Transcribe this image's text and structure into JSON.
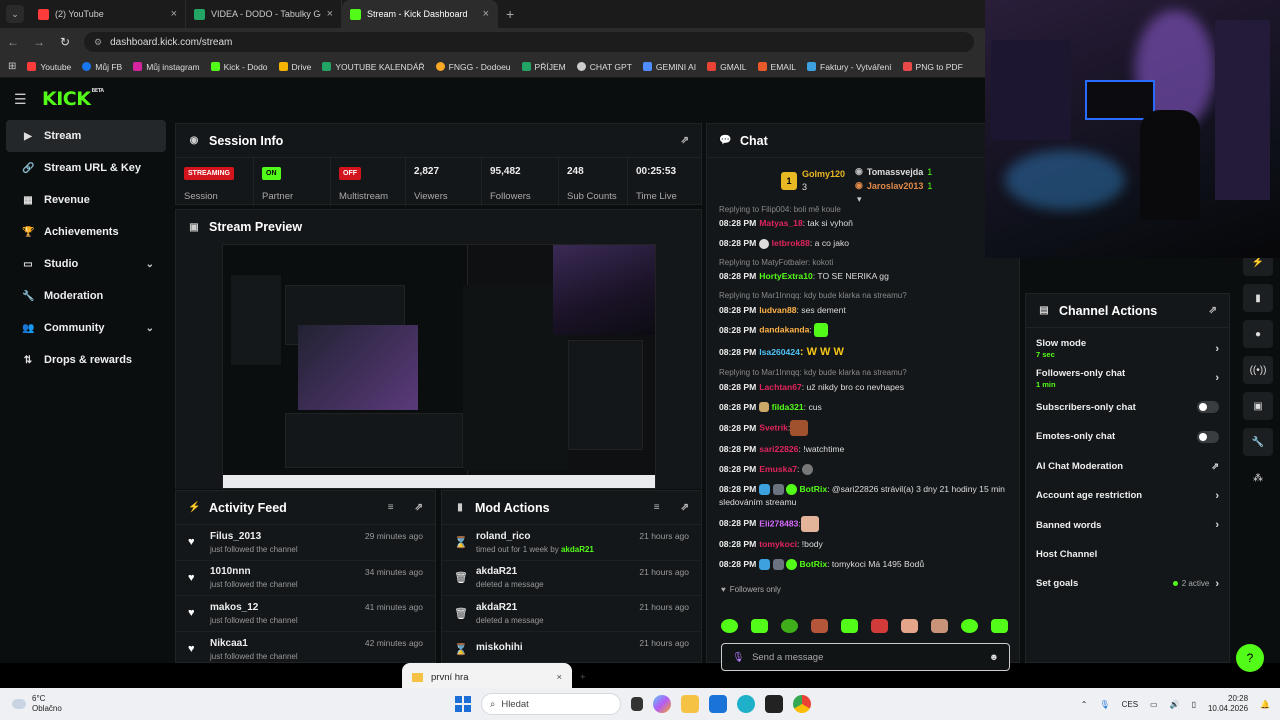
{
  "browser": {
    "tabs": [
      {
        "title": "(2) YouTube",
        "color": "#ff3b3b"
      },
      {
        "title": "VIDEA - DODO - Tabulky Googl",
        "color": "#21a464"
      },
      {
        "title": "Stream - Kick Dashboard",
        "color": "#53fc18"
      }
    ],
    "url": "dashboard.kick.com/stream",
    "bookmarks": [
      {
        "label": "Youtube",
        "color": "#ff3b3b"
      },
      {
        "label": "Můj FB",
        "color": "#1877f2"
      },
      {
        "label": "Můj instagram",
        "color": "#d6249f"
      },
      {
        "label": "Kick - Dodo",
        "color": "#53fc18"
      },
      {
        "label": "Drive",
        "color": "#f4b400"
      },
      {
        "label": "YOUTUBE KALENDÁŘ",
        "color": "#21a464"
      },
      {
        "label": "FNGG - Dodoeu",
        "color": "#f9a825"
      },
      {
        "label": "PŘÍJEM",
        "color": "#21a464"
      },
      {
        "label": "CHAT GPT",
        "color": "#cccccc"
      },
      {
        "label": "GEMINI AI",
        "color": "#4e8cff"
      },
      {
        "label": "GMAIL",
        "color": "#ea4335"
      },
      {
        "label": "EMAIL",
        "color": "#e85a2a"
      },
      {
        "label": "Faktury - Vytváření",
        "color": "#3da1e0"
      },
      {
        "label": "PNG to PDF",
        "color": "#e84a4a"
      }
    ]
  },
  "brand": {
    "logo": "KICK",
    "beta": "BETA"
  },
  "sidebar": {
    "items": [
      {
        "label": "Stream",
        "icon": "▶"
      },
      {
        "label": "Stream URL & Key",
        "icon": "🔗"
      },
      {
        "label": "Revenue",
        "icon": "▦"
      },
      {
        "label": "Achievements",
        "icon": "🏆"
      },
      {
        "label": "Studio",
        "icon": "▭"
      },
      {
        "label": "Moderation",
        "icon": "🔧"
      },
      {
        "label": "Community",
        "icon": "👥"
      },
      {
        "label": "Drops & rewards",
        "icon": "⇅"
      }
    ]
  },
  "session": {
    "title": "Session Info",
    "stats": [
      {
        "pill": "STREAMING",
        "caption": "Session"
      },
      {
        "pill": "ON",
        "caption": "Partner"
      },
      {
        "pill": "OFF",
        "caption": "Multistream"
      },
      {
        "value": "2,827",
        "caption": "Viewers"
      },
      {
        "value": "95,482",
        "caption": "Followers"
      },
      {
        "value": "248",
        "caption": "Sub Counts"
      },
      {
        "value": "00:25:53",
        "caption": "Time Live"
      }
    ]
  },
  "preview": {
    "title": "Stream Preview"
  },
  "activity": {
    "title": "Activity Feed",
    "items": [
      {
        "name": "Filus_2013",
        "sub": "just followed the channel",
        "time": "29 minutes ago"
      },
      {
        "name": "1010nnn",
        "sub": "just followed the channel",
        "time": "34 minutes ago"
      },
      {
        "name": "makos_12",
        "sub": "just followed the channel",
        "time": "41 minutes ago"
      },
      {
        "name": "Nikcaa1",
        "sub": "just followed the channel",
        "time": "42 minutes ago"
      }
    ]
  },
  "mod": {
    "title": "Mod Actions",
    "items": [
      {
        "name": "roland_rico",
        "sub": "timed out for 1 week by",
        "by": "akdaR21",
        "time": "21 hours ago"
      },
      {
        "name": "akdaR21",
        "sub": "deleted a message",
        "by": "",
        "time": "21 hours ago"
      },
      {
        "name": "akdaR21",
        "sub": "deleted a message",
        "by": "",
        "time": "21 hours ago"
      },
      {
        "name": "miskohihi",
        "sub": "",
        "by": "",
        "time": "21 hours ago"
      }
    ]
  },
  "chat": {
    "title": "Chat",
    "top": {
      "first": "Golmy120",
      "first_count": "3",
      "second": "Tomassvejda",
      "second_count": "1",
      "third": "Jaroslav2013",
      "third_count": "1",
      "rank": "1"
    },
    "messages": [
      {
        "reply": "Replying to Filip004: boli mě koule",
        "time": "08:28 PM",
        "user": "Matyas_18",
        "color": "#e0245e",
        "text": ": tak si vyhoň"
      },
      {
        "reply": "",
        "time": "08:28 PM",
        "user": "letbrok88",
        "color": "#e0245e",
        "text": ": a co jako"
      },
      {
        "reply": "Replying to MatyFotbaler: kokoti",
        "time": "08:28 PM",
        "user": "HortyExtra10",
        "color": "#53fc18",
        "text": ": TO SE NERIKA gg"
      },
      {
        "reply": "Replying to Mar1Innqq: kdy bude klarka na streamu?",
        "time": "08:28 PM",
        "user": "ludvan88",
        "color": "#ffb347",
        "text": ": ses dement"
      },
      {
        "reply": "",
        "time": "08:28 PM",
        "user": "dandakanda",
        "color": "#ffb347",
        "text": ":"
      },
      {
        "reply": "",
        "time": "08:28 PM",
        "user": "Isa260424",
        "color": "#4fc3f7",
        "text": ": W W W"
      },
      {
        "reply": "Replying to Mar1Innqq: kdy bude klarka na streamu?",
        "time": "08:28 PM",
        "user": "Lachtan67",
        "color": "#e0245e",
        "text": ": už nikdy bro co nevhapes"
      },
      {
        "reply": "",
        "time": "08:28 PM",
        "user": "filda321",
        "color": "#53fc18",
        "text": ": cus"
      },
      {
        "reply": "",
        "time": "08:28 PM",
        "user": "Svetrik",
        "color": "#e0245e",
        "text": ":"
      },
      {
        "reply": "",
        "time": "08:28 PM",
        "user": "sari22826",
        "color": "#e0245e",
        "text": ": !watchtime"
      },
      {
        "reply": "",
        "time": "08:28 PM",
        "user": "Emuska7",
        "color": "#e0245e",
        "text": ":"
      },
      {
        "reply": "",
        "time": "08:28 PM",
        "user": "BotRix",
        "color": "#53fc18",
        "text": ": @sari22826 strávil(a) 3 dny 21 hodiny 15 min sledováním streamu"
      },
      {
        "reply": "",
        "time": "08:28 PM",
        "user": "Eli278483",
        "color": "#d66bff",
        "text": ":"
      },
      {
        "reply": "",
        "time": "08:28 PM",
        "user": "tomykoci",
        "color": "#e0245e",
        "text": ": !body"
      },
      {
        "reply": "",
        "time": "08:28 PM",
        "user": "BotRix",
        "color": "#53fc18",
        "text": ": tomykoci Má 1495 Bodů"
      }
    ],
    "followers_only": "Followers only",
    "placeholder": "Send a message"
  },
  "channel_actions": {
    "title": "Channel Actions",
    "items": [
      {
        "label": "Slow mode",
        "sub": "7 sec",
        "control": "chevron"
      },
      {
        "label": "Followers-only chat",
        "sub": "1 min",
        "control": "chevron"
      },
      {
        "label": "Subscribers-only chat",
        "sub": "",
        "control": "toggle"
      },
      {
        "label": "Emotes-only chat",
        "sub": "",
        "control": "toggle"
      },
      {
        "label": "AI Chat Moderation",
        "sub": "",
        "control": "pop"
      },
      {
        "label": "Account age restriction",
        "sub": "",
        "control": "chevron"
      },
      {
        "label": "Banned words",
        "sub": "",
        "control": "chevron"
      },
      {
        "label": "Host Channel",
        "sub": "",
        "control": "none"
      },
      {
        "label": "Set goals",
        "sub": "",
        "control": "chevron",
        "badge": "2 active"
      }
    ]
  },
  "taskbar": {
    "window_title": "první hra",
    "weather_temp": "6°C",
    "weather_desc": "Oblačno",
    "search": "Hledat",
    "lang": "CES",
    "time": "20:28",
    "date": "10.04.2026"
  },
  "colors": {
    "accent": "#53fc18",
    "panel": "#141719",
    "bg": "#0b0e0f"
  }
}
